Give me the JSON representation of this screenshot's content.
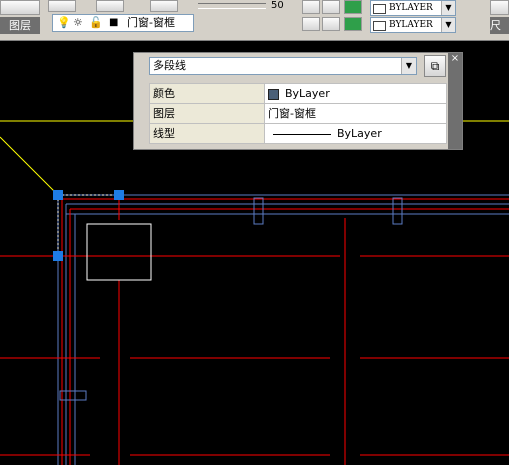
{
  "ribbon": {
    "panel_title": "图层",
    "right_panel_title": "尺寸",
    "layer_name": "门窗-窗框",
    "slider_value": "50",
    "color_combo": "BYLAYER",
    "linetype_combo": "BYLAYER"
  },
  "properties": {
    "object_type": "多段线",
    "rows": [
      {
        "key": "颜色",
        "value": "ByLayer"
      },
      {
        "key": "图层",
        "value": "门窗-窗框"
      },
      {
        "key": "线型",
        "value": "ByLayer"
      }
    ],
    "close_symbol": "×",
    "color_swatch": "#4a5f77"
  },
  "colors": {
    "background": "#000000",
    "red_lines": "#ff0000",
    "blue_lines": "#5b7cc4",
    "grip": "#1e7ce6",
    "yellow": "#ffff00"
  }
}
